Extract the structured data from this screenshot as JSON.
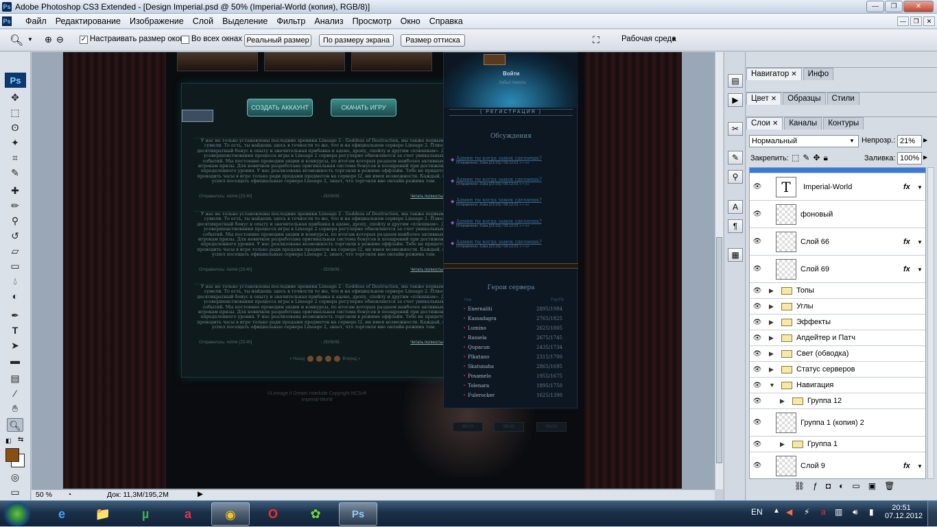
{
  "window": {
    "title": "Adobe Photoshop CS3 Extended - [Design Imperial.psd @ 50% (Imperial-World (копия), RGB/8)]",
    "app_icon": "Ps",
    "min": "—",
    "max": "❐",
    "close": "✕"
  },
  "menu": {
    "items": [
      "Файл",
      "Редактирование",
      "Изображение",
      "Слой",
      "Выделение",
      "Фильтр",
      "Анализ",
      "Просмотр",
      "Окно",
      "Справка"
    ]
  },
  "options": {
    "resize_windows": "Настраивать размер окон",
    "all_windows": "Во всех окнах",
    "actual_pixels": "Реальный размер",
    "fit_screen": "По размеру экрана",
    "print_size": "Размер оттиска",
    "workspace": "Рабочая среда",
    "resize_checked": true,
    "all_checked": false
  },
  "toolbox": {
    "badge": "Ps"
  },
  "canvas": {
    "buttons": [
      "СОЗДАТЬ АККАУНТ",
      "СКАЧАТЬ ИГРУ"
    ],
    "login": "Войти",
    "forgot": "Забыл пароль",
    "registration": "( РЕГИСТРАЦИЯ )",
    "discussions_title": "Обсуждения",
    "discussions": [
      {
        "q": "Админ ты когда замок сделаешь?",
        "a": "Отправлено:  Zuka   [23:15] / 09.12.01  « • »»"
      },
      {
        "q": "Админ ты когда замок сделаешь?",
        "a": "Отправлено:  Zuka   [23:15] / 09.12.01  « • »»"
      },
      {
        "q": "Админ ты когда замок сделаешь?",
        "a": "Отправлено:  Zuka   [23:15] / 09.12.01  « • »»"
      },
      {
        "q": "Админ ты когда замок сделаешь?",
        "a": "Отправлено:  Zuka   [23:15] / 09.12.01  « • »»"
      },
      {
        "q": "Админ ты когда замок сделаешь?",
        "a": "Отправлено:  Zuka   [23:15] / 09.12.01  « • »»"
      }
    ],
    "heroes_title": "Герои сервера",
    "heroes_head": [
      "Ник",
      "Pvp/Pk"
    ],
    "heroes": [
      {
        "name": "Enernaliti",
        "score": "2895/1984"
      },
      {
        "name": "Kassadagra",
        "score": "2765/1825"
      },
      {
        "name": "Lumino",
        "score": "2625/1805"
      },
      {
        "name": "Rassela",
        "score": "2675/1745"
      },
      {
        "name": "Qupacun",
        "score": "2435/1734"
      },
      {
        "name": "Plkatano",
        "score": "2315/1700"
      },
      {
        "name": "Skatunaha",
        "score": "2865/1695"
      },
      {
        "name": "Posamelo",
        "score": "1955/1675"
      },
      {
        "name": "Tolenara",
        "score": "1895/1750"
      },
      {
        "name": "Fulerocker",
        "score": "1625/1390"
      }
    ],
    "news_text": "У нас не только установлены последние хроники Lineage 2 - Goddess of Destruction, мы также первыми сумели. То есть, ты найдешь здесь в точности то же, что и на официальном сервере Lineage 2. Плюс десятикратный бонус к опыту и значительная прибавка к адене, дропу, спойлу и другим «плюшкам». Для усовершенствования процесса игры в Lineage 2 сервера регулярно обновляются за счет уникальных событий. Мы постоянно проводим акции и конкурсы, по итогам которых раздаем наиболее активным игрокам призы. Для новичков разработана оригинальная система бонусов и поощрений при достижении определенного уровня. У нас реализована возможность торговли в режиме оффлайн. Тебе не придется проводить часы в игре только ради продажи предметов на сервере l2, ни имея возможности. Каждый, кто успел посещать официальные сервера Lineage 2, знает, что торговля вне онлайн-режима там.",
    "news_meta": {
      "by": "Отправилось:  Admin   [23:40]",
      "date": "- 25/09/08 -",
      "more": "Читать полностью »"
    },
    "pager": "« Назад",
    "pager_next": "Вперед »",
    "footer": "©Lineage II Dream Interlude Copyright NCSoft",
    "footer2": "Imperial-World",
    "badges": [
      "88x33",
      "88x33",
      "88x33"
    ]
  },
  "status": {
    "zoom": "50 %",
    "doc": "Док: 11,3M/195,2M"
  },
  "panels": {
    "nav_tabs": [
      {
        "label": "Навигатор",
        "close": "✕"
      },
      {
        "label": "Инфо"
      }
    ],
    "color_tabs": [
      {
        "label": "Цвет",
        "close": "✕"
      },
      {
        "label": "Образцы"
      },
      {
        "label": "Стили"
      }
    ],
    "layer_tabs": [
      {
        "label": "Слои",
        "close": "✕"
      },
      {
        "label": "Каналы"
      },
      {
        "label": "Контуры"
      }
    ],
    "blend_mode": "Нормальный",
    "opacity_label": "Непрозр.:",
    "opacity": "21%",
    "lock_label": "Закрепить:",
    "fill_label": "Заливка:",
    "fill": "100%",
    "layers": [
      {
        "name": "Imperial-World",
        "kind": "text",
        "fx": "fx"
      },
      {
        "name": "фоновый",
        "kind": "pixel"
      },
      {
        "name": "Слой 66",
        "kind": "pixel",
        "fx": "fx"
      },
      {
        "name": "Слой 69",
        "kind": "pixel",
        "fx": "fx"
      },
      {
        "name": "Топы",
        "kind": "group"
      },
      {
        "name": "Углы",
        "kind": "group"
      },
      {
        "name": "Эффекты",
        "kind": "group"
      },
      {
        "name": "Апдейтер и Патч",
        "kind": "group"
      },
      {
        "name": "Свет (обводка)",
        "kind": "group"
      },
      {
        "name": "Статус серверов",
        "kind": "group"
      },
      {
        "name": "Навигация",
        "kind": "group-open"
      },
      {
        "name": "Группа 12",
        "kind": "subgroup"
      },
      {
        "name": "Группа 1 (копия) 2",
        "kind": "pixel"
      },
      {
        "name": "Группа 1",
        "kind": "subgroup"
      },
      {
        "name": "Слой 9",
        "kind": "pixel",
        "fx": "fx"
      }
    ]
  },
  "taskbar": {
    "lang": "EN",
    "time": "20:51",
    "date": "07.12.2012",
    "apps": [
      "e",
      "📁",
      "µ",
      "a",
      "◉",
      "O",
      "✿",
      "Ps"
    ]
  }
}
